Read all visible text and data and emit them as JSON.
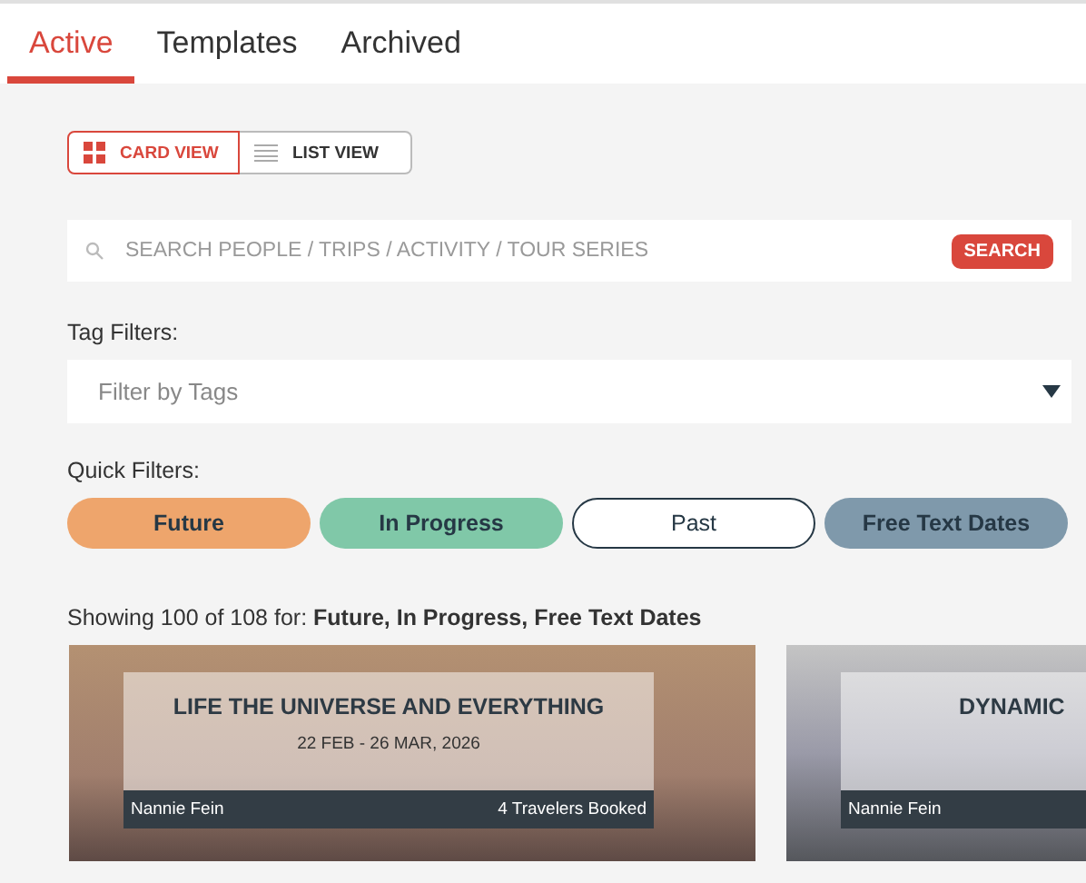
{
  "tabs": [
    {
      "label": "Active",
      "selected": true
    },
    {
      "label": "Templates",
      "selected": false
    },
    {
      "label": "Archived",
      "selected": false
    }
  ],
  "view_toggle": [
    {
      "label": "CARD VIEW",
      "kind": "grid",
      "selected": true
    },
    {
      "label": "LIST VIEW",
      "kind": "list",
      "selected": false
    }
  ],
  "search": {
    "placeholder": "SEARCH PEOPLE / TRIPS / ACTIVITY / TOUR SERIES",
    "button": "SEARCH"
  },
  "tag_filters": {
    "label": "Tag Filters:",
    "placeholder": "Filter by Tags"
  },
  "quick_filters": {
    "label": "Quick Filters:",
    "items": [
      {
        "label": "Future",
        "selected": true,
        "color": "#eea56c"
      },
      {
        "label": "In Progress",
        "selected": true,
        "color": "#80c8a8"
      },
      {
        "label": "Past",
        "selected": false,
        "color": "#263845"
      },
      {
        "label": "Free Text Dates",
        "selected": true,
        "color": "#7f99ab"
      }
    ]
  },
  "summary": "Showing 100 of 108 for: **Future, In Progress, Free Text Dates**",
  "cards": [
    {
      "title": "LIFE THE UNIVERSE AND EVERYTHING",
      "dates": "22 FEB - 26 MAR, 2026",
      "author": "Nannie Fein",
      "bookings": "4 Travelers Booked",
      "kind": "birds"
    },
    {
      "title": "DYNAMIC",
      "author": "Nannie Fein",
      "kind": "mountains"
    }
  ]
}
